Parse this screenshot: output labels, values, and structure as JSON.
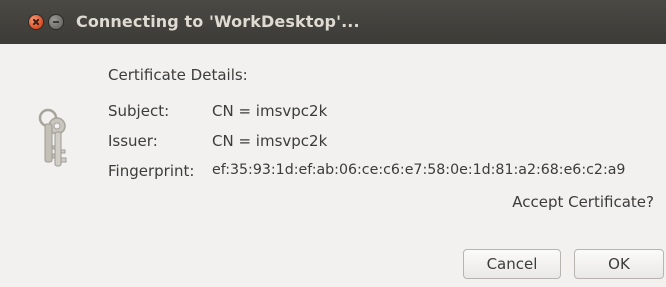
{
  "window": {
    "title": "Connecting to 'WorkDesktop'..."
  },
  "icons": {
    "close": "close-icon",
    "minimize": "minimize-icon",
    "dialog": "keys-icon"
  },
  "dialog": {
    "heading": "Certificate Details:",
    "fields": [
      {
        "label": "Subject:",
        "value": "CN = imsvpc2k"
      },
      {
        "label": "Issuer:",
        "value": "CN = imsvpc2k"
      },
      {
        "label": "Fingerprint:",
        "value": "ef:35:93:1d:ef:ab:06:ce:c6:e7:58:0e:1d:81:a2:68:e6:c2:a9"
      }
    ],
    "question": "Accept Certificate?"
  },
  "buttons": {
    "cancel": "Cancel",
    "ok": "OK"
  }
}
